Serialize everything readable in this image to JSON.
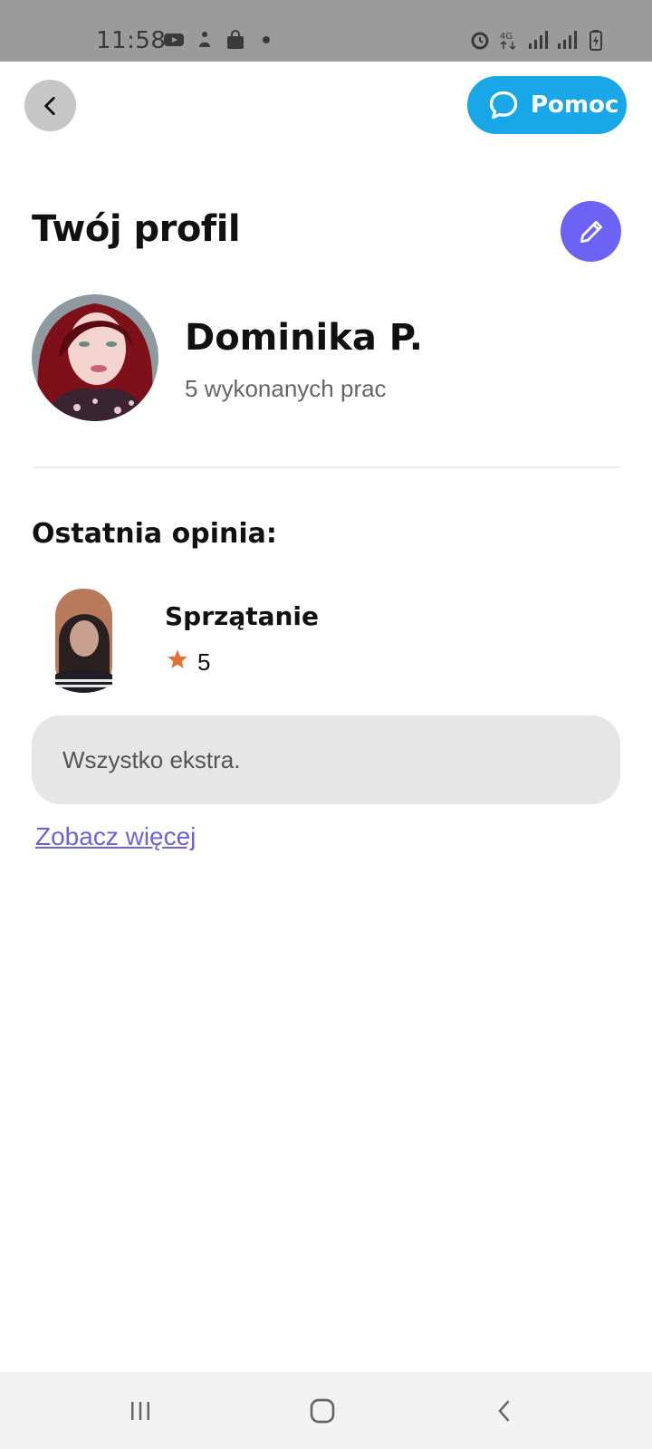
{
  "status_bar": {
    "time": "11:58",
    "left_icons": [
      "youtube-icon",
      "notification-icon",
      "shopping-bag-icon",
      "dot-icon"
    ],
    "right_icons": [
      "alarm-icon",
      "4g-icon",
      "signal-icon",
      "signal-icon",
      "battery-icon"
    ]
  },
  "header": {
    "back_icon": "chevron-left-icon",
    "help_label": "Pomoc",
    "help_icon": "chat-bubble-icon"
  },
  "profile": {
    "title": "Twój profil",
    "edit_icon": "pencil-icon",
    "name": "Dominika P.",
    "jobs": "5 wykonanych prac"
  },
  "review": {
    "section_title": "Ostatnia opinia:",
    "category": "Sprzątanie",
    "rating": "5",
    "text": "Wszystko ekstra.",
    "see_more": "Zobacz więcej"
  },
  "colors": {
    "help_button": "#1aa7e8",
    "edit_button": "#6c63f5",
    "star": "#e0733b",
    "link": "#6c63d8"
  },
  "nav_bar": {
    "buttons": [
      "recents-icon",
      "home-icon",
      "back-icon"
    ]
  }
}
